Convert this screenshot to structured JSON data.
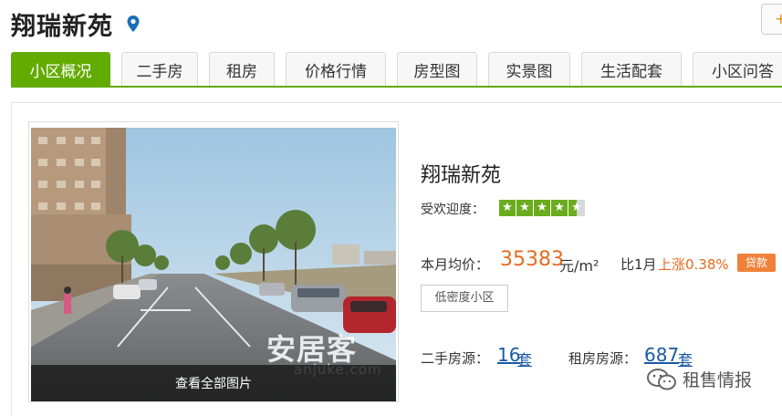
{
  "header": {
    "title": "翔瑞新苑",
    "location_icon": "map-pin-icon",
    "corner_button_icon": "plus-icon"
  },
  "tabs": [
    {
      "label": "小区概况",
      "active": true
    },
    {
      "label": "二手房",
      "active": false
    },
    {
      "label": "租房",
      "active": false
    },
    {
      "label": "价格行情",
      "active": false
    },
    {
      "label": "房型图",
      "active": false
    },
    {
      "label": "实景图",
      "active": false
    },
    {
      "label": "生活配套",
      "active": false
    },
    {
      "label": "小区问答",
      "active": false
    }
  ],
  "photo": {
    "view_all_label": "查看全部图片",
    "watermark": "安居客",
    "watermark_domain": "anjuke.com"
  },
  "info": {
    "name": "翔瑞新苑",
    "popularity_label": "受欢迎度：",
    "popularity_rating": 4.5,
    "popularity_max": 5,
    "price_label": "本月均价：",
    "price_value": "35383",
    "price_unit": "元/m²",
    "mom_label": "比1月",
    "mom_change": "上涨0.38%",
    "loan_button": "贷款",
    "tag": "低密度小区",
    "resale_label": "二手房源：",
    "resale_count": "16",
    "resale_unit": "套",
    "rent_label": "租房房源：",
    "rent_count": "687",
    "rent_unit": "套"
  },
  "overlay": {
    "wechat_text": "租售情报"
  },
  "colors": {
    "accent_green": "#62ab00",
    "price_orange": "#e56b1f",
    "link_blue": "#1a5aa6",
    "loan_orange": "#f0813a"
  }
}
